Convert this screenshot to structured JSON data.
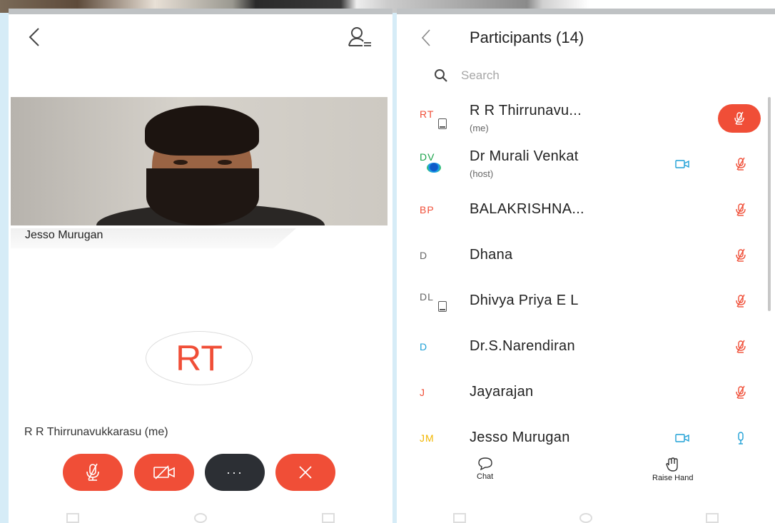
{
  "colors": {
    "accent": "#f04e37",
    "dark_button": "#2c2f34",
    "link_blue": "#1ea0d6",
    "video_icon": "#1ea0d6"
  },
  "meeting_view": {
    "video_tile_name": "Jesso Murugan",
    "self_avatar_initials": "RT",
    "self_name": "R R Thirrunavukkarasu (me)",
    "controls": [
      {
        "icon": "mic-muted-icon"
      },
      {
        "icon": "video-off-icon"
      },
      {
        "icon": "more-icon",
        "label": "···"
      },
      {
        "icon": "leave-icon"
      }
    ]
  },
  "participants_view": {
    "title": "Participants (14)",
    "search_placeholder": "Search",
    "participants": [
      {
        "initials": "RT",
        "initials_color": "#f04e37",
        "name": "R R Thirrunavu...",
        "role": "(me)",
        "device": true,
        "video": false,
        "mic": "muted-active"
      },
      {
        "initials": "DV",
        "initials_color": "#1aa34a",
        "name": "Dr Murali Venkat",
        "role": "(host)",
        "device": false,
        "video": true,
        "mic": "muted"
      },
      {
        "initials": "BP",
        "initials_color": "#f04e37",
        "name": "BALAKRISHNA...",
        "role": "",
        "device": false,
        "video": false,
        "mic": "muted"
      },
      {
        "initials": "D",
        "initials_color": "#666666",
        "name": "Dhana",
        "role": "",
        "device": false,
        "video": false,
        "mic": "muted"
      },
      {
        "initials": "DL",
        "initials_color": "#666666",
        "name": "Dhivya Priya E L",
        "role": "",
        "device": true,
        "video": false,
        "mic": "muted"
      },
      {
        "initials": "D",
        "initials_color": "#1ea0d6",
        "name": "Dr.S.Narendiran",
        "role": "",
        "device": false,
        "video": false,
        "mic": "muted"
      },
      {
        "initials": "J",
        "initials_color": "#f04e37",
        "name": "Jayarajan",
        "role": "",
        "device": false,
        "video": false,
        "mic": "muted"
      },
      {
        "initials": "JM",
        "initials_color": "#f2b600",
        "name": "Jesso Murugan",
        "role": "",
        "device": false,
        "video": true,
        "mic": "on"
      }
    ],
    "actions": {
      "chat": "Chat",
      "raise_hand": "Raise Hand"
    }
  }
}
